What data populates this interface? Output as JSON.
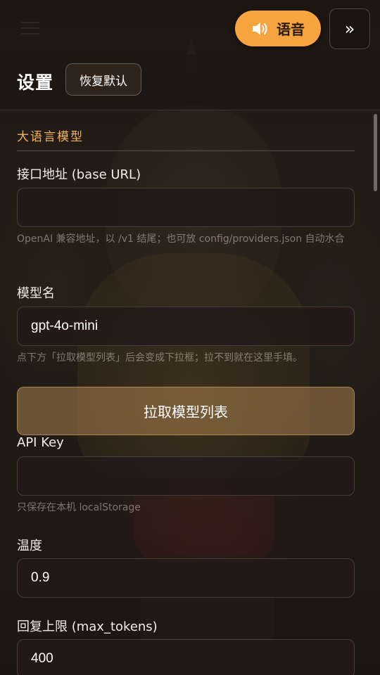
{
  "topbar": {
    "voice_label": "语音",
    "collapse_label": "»"
  },
  "settings": {
    "title": "设置",
    "reset_label": "恢复默认",
    "section_title": "大语言模型",
    "base_url": {
      "label": "接口地址 (base URL)",
      "value": "",
      "hint": "OpenAI 兼容地址，以 /v1 结尾；也可放 config/providers.json 自动水合"
    },
    "model": {
      "label": "模型名",
      "value": "gpt-4o-mini",
      "hint": "点下方「拉取模型列表」后会变成下拉框；拉不到就在这里手填。"
    },
    "fetch_models_label": "拉取模型列表",
    "api_key": {
      "label": "API Key",
      "value": "",
      "hint": "只保存在本机 localStorage"
    },
    "temperature": {
      "label": "温度",
      "value": "0.9"
    },
    "max_tokens": {
      "label": "回复上限 (max_tokens)",
      "value": "400"
    }
  },
  "colors": {
    "accent": "#f6a53e",
    "section_title": "#f0b45c"
  },
  "icons": {
    "menu": "hamburger-icon",
    "voice": "speaker-icon"
  }
}
